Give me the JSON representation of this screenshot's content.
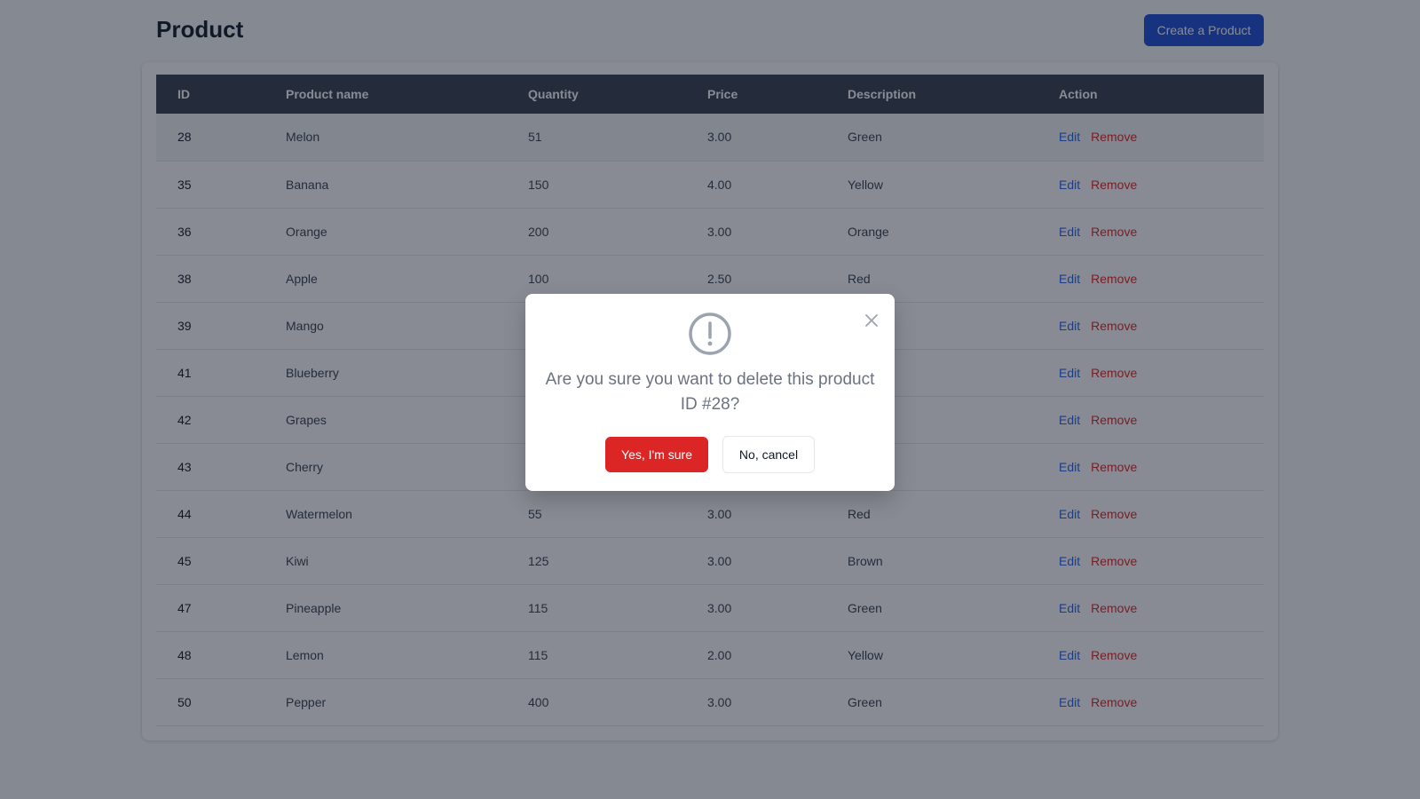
{
  "header": {
    "title": "Product",
    "create_label": "Create a Product"
  },
  "table": {
    "columns": [
      "ID",
      "Product name",
      "Quantity",
      "Price",
      "Description",
      "Action"
    ],
    "rows": [
      {
        "id": "28",
        "name": "Melon",
        "quantity": "51",
        "price": "3.00",
        "description": "Green"
      },
      {
        "id": "35",
        "name": "Banana",
        "quantity": "150",
        "price": "4.00",
        "description": "Yellow"
      },
      {
        "id": "36",
        "name": "Orange",
        "quantity": "200",
        "price": "3.00",
        "description": "Orange"
      },
      {
        "id": "38",
        "name": "Apple",
        "quantity": "100",
        "price": "2.50",
        "description": "Red"
      },
      {
        "id": "39",
        "name": "Mango",
        "quantity": "",
        "price": "",
        "description": ""
      },
      {
        "id": "41",
        "name": "Blueberry",
        "quantity": "",
        "price": "",
        "description": ""
      },
      {
        "id": "42",
        "name": "Grapes",
        "quantity": "",
        "price": "",
        "description": ""
      },
      {
        "id": "43",
        "name": "Cherry",
        "quantity": "",
        "price": "",
        "description": ""
      },
      {
        "id": "44",
        "name": "Watermelon",
        "quantity": "55",
        "price": "3.00",
        "description": "Red"
      },
      {
        "id": "45",
        "name": "Kiwi",
        "quantity": "125",
        "price": "3.00",
        "description": "Brown"
      },
      {
        "id": "47",
        "name": "Pineapple",
        "quantity": "115",
        "price": "3.00",
        "description": "Green"
      },
      {
        "id": "48",
        "name": "Lemon",
        "quantity": "115",
        "price": "2.00",
        "description": "Yellow"
      },
      {
        "id": "50",
        "name": "Pepper",
        "quantity": "400",
        "price": "3.00",
        "description": "Green"
      }
    ],
    "edit_label": "Edit",
    "remove_label": "Remove"
  },
  "modal": {
    "message": "Are you sure you want to delete this product ID #28?",
    "confirm_label": "Yes, I'm sure",
    "cancel_label": "No, cancel",
    "icon": "exclamation-circle-icon",
    "close_icon": "close-icon"
  },
  "colors": {
    "primary": "#1d4ed8",
    "danger": "#dc2626",
    "header_bg": "#374151"
  }
}
